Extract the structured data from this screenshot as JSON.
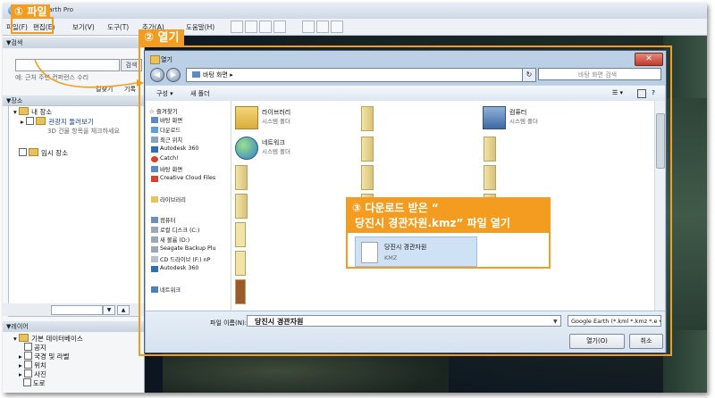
{
  "ge": {
    "title": "Google Earth Pro",
    "menu": [
      "파일(F)",
      "편집(E)",
      "보기(V)",
      "도구(T)",
      "추가(A)",
      "도움말(H)"
    ]
  },
  "sidebar": {
    "search_header": "▼검색",
    "search_button": "검색",
    "search_hint": "예: 근처 주변 컨퍼런스 수리",
    "links": [
      "길찾기",
      "기록"
    ],
    "places_header": "▼장소",
    "my_places": "내 장소",
    "sightseeing": "관광지 둘러보기",
    "sightseeing_hint": "3D 건물 항목을 체크하세요",
    "temp_places": "임시 장소",
    "layers_header": "▼레이어",
    "layers": [
      "기본 데이터베이스",
      "공지",
      "국경 및 라벨",
      "위치",
      "사진",
      "도로"
    ]
  },
  "dialog": {
    "title": "열기",
    "address": "바탕 화면 ▸",
    "search_placeholder": "바탕 화면 검색",
    "toolbar": {
      "organize": "구성 ▾",
      "new_folder": "새 폴더"
    },
    "nav": {
      "favorites_header": "☆ 즐겨찾기",
      "favorites": [
        "바탕 화면",
        "다운로드",
        "최근 위치",
        "Autodesk 360",
        "Catch!",
        "바탕 화면",
        "Creative Cloud Files"
      ],
      "libraries_header": "라이브러리",
      "computer_header": "컴퓨터",
      "drives": [
        "로컬 디스크 (C:)",
        "새 볼륨 (D:)",
        "Seagate Backup Plu",
        "CD 드라이브 (F:) nP",
        "Autodesk 360"
      ],
      "network_header": "네트워크"
    },
    "items": [
      {
        "name": "라이브러리",
        "sub": "시스템 폴더"
      },
      {
        "name": "컴퓨터",
        "sub": "시스템 폴더"
      },
      {
        "name": "네트워크",
        "sub": "시스템 폴더"
      }
    ],
    "kmz": {
      "name": "당진시 경관자원",
      "type": "KMZ"
    },
    "filename_label": "파일 이름(N):",
    "filename_value": "당진시 경관자원",
    "filetype_value": "Google Earth (*.kml *.kmz *.e ▾",
    "open_button": "열기(O)",
    "cancel_button": "취소"
  },
  "annotations": {
    "step1": "① 파일",
    "step2": "② 열기",
    "step3_line1": "③ 다운로드 받은 “",
    "step3_line2": "당진시 경관자원.kmz” 파일 열기"
  },
  "colors": {
    "annotation": "#f39c1f",
    "selection": "#cfe1f5"
  }
}
